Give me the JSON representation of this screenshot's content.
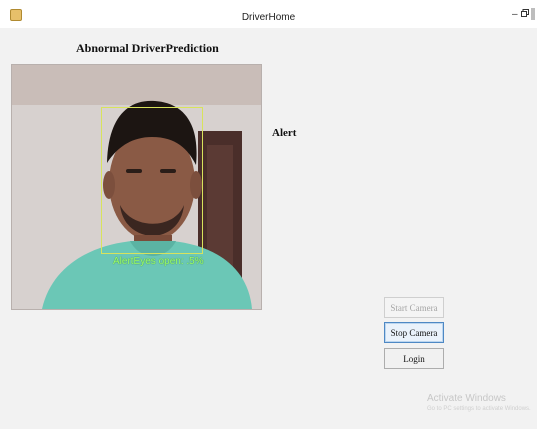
{
  "window": {
    "title": "DriverHome",
    "controls": {
      "minimize": "–",
      "restore": "⧉"
    }
  },
  "form": {
    "heading": "Abnormal DriverPrediction",
    "alert_label": "Alert"
  },
  "camera_view": {
    "overlay_text": "AlertEyes open: .5%"
  },
  "buttons": {
    "start_camera": "Start Camera",
    "stop_camera": "Stop Camera",
    "login": "Login"
  },
  "activation_watermark": {
    "title": "Activate Windows",
    "subtitle": "Go to PC settings to activate Windows."
  }
}
